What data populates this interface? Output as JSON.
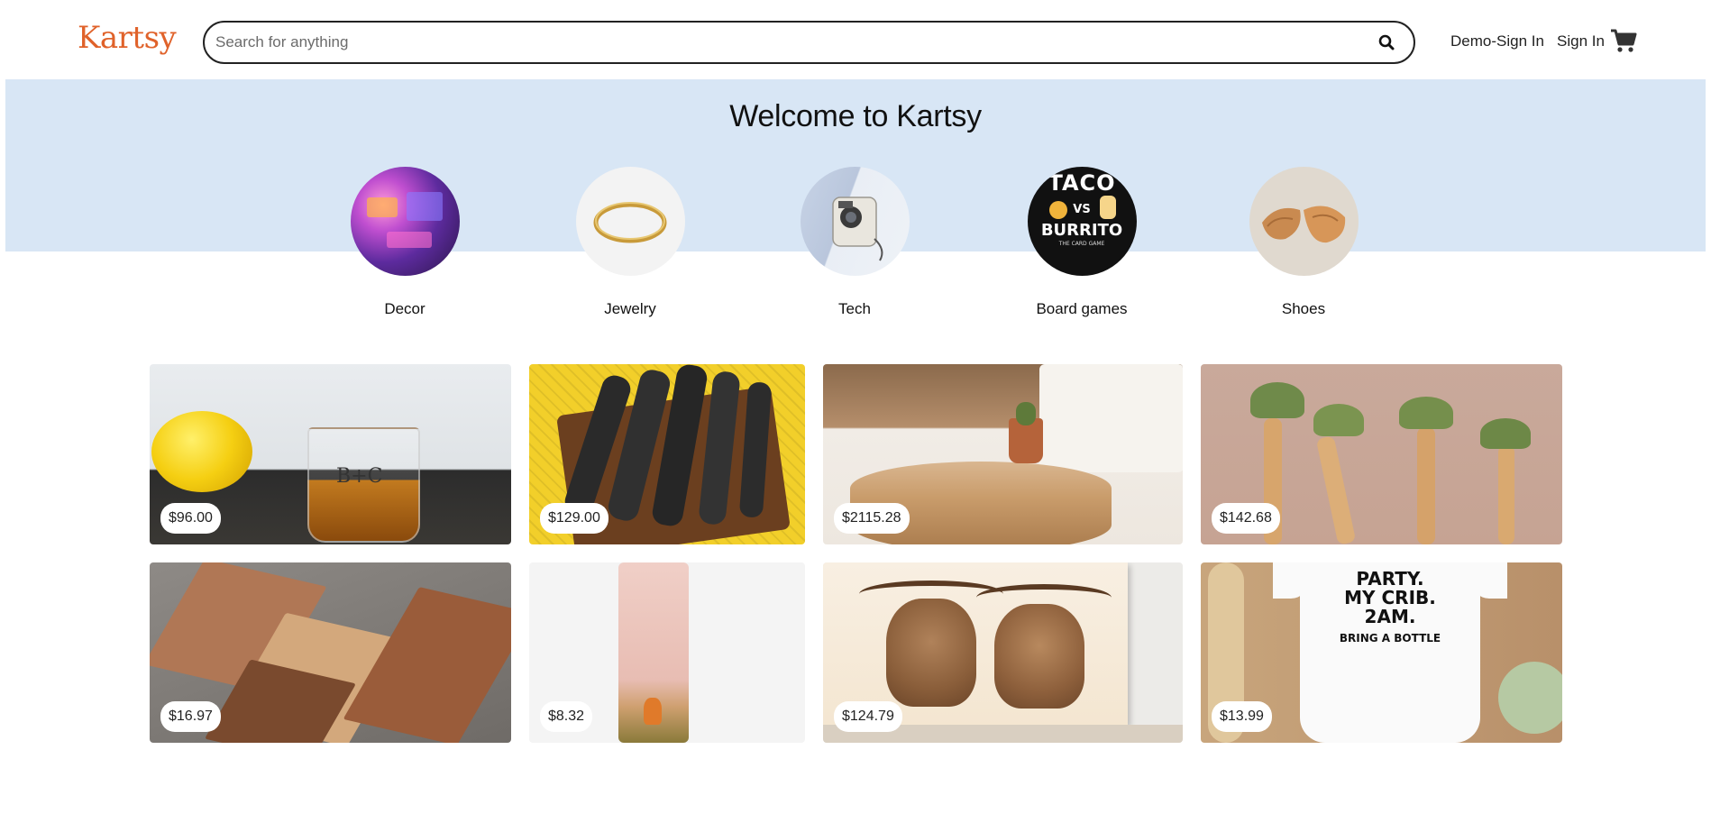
{
  "header": {
    "logo": "Kartsy",
    "search_placeholder": "Search for anything",
    "demo_signin": "Demo-Sign In",
    "signin": "Sign In",
    "icons": {
      "search": "search-icon",
      "cart": "cart-icon"
    }
  },
  "hero": {
    "title": "Welcome to Kartsy",
    "categories": [
      {
        "label": "Decor"
      },
      {
        "label": "Jewelry"
      },
      {
        "label": "Tech"
      },
      {
        "label": "Board games"
      },
      {
        "label": "Shoes"
      }
    ],
    "board_game_art": [
      "TACO",
      "VS",
      "BURRITO",
      "THE CARD GAME"
    ]
  },
  "products": [
    {
      "price": "$96.00",
      "art": "B+C"
    },
    {
      "price": "$129.00"
    },
    {
      "price": "$2115.28"
    },
    {
      "price": "$142.68"
    },
    {
      "price": "$16.97"
    },
    {
      "price": "$8.32"
    },
    {
      "price": "$124.79"
    },
    {
      "price": "$13.99",
      "art": [
        "PARTY.",
        "MY CRIB.",
        "2AM.",
        "BRING A BOTTLE"
      ]
    }
  ],
  "colors": {
    "brand": "#e0622a",
    "hero_bg": "#d8e6f5",
    "text": "#222222"
  }
}
